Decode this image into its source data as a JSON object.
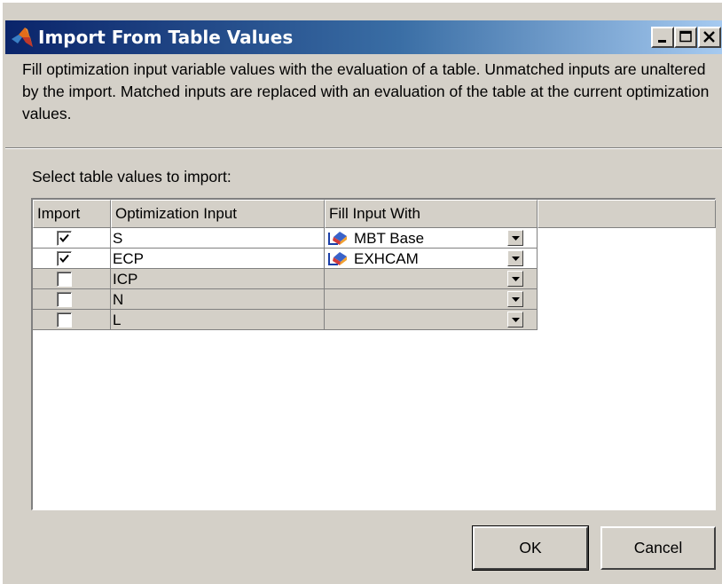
{
  "window": {
    "title": "Import From Table Values",
    "buttons": [
      "minimize",
      "maximize",
      "close"
    ]
  },
  "description": "Fill optimization input variable values with the evaluation of a table. Unmatched inputs are unaltered by the import. Matched inputs are replaced with an evaluation of the table at the current optimization values.",
  "select_label": "Select table values to import:",
  "table": {
    "headers": [
      "Import",
      "Optimization Input",
      "Fill Input With"
    ],
    "rows": [
      {
        "checked": true,
        "input": "S",
        "fill": "MBT  Base",
        "enabled": true
      },
      {
        "checked": true,
        "input": "ECP",
        "fill": "EXHCAM",
        "enabled": true
      },
      {
        "checked": false,
        "input": "ICP",
        "fill": "",
        "enabled": false
      },
      {
        "checked": false,
        "input": "N",
        "fill": "",
        "enabled": false
      },
      {
        "checked": false,
        "input": "L",
        "fill": "",
        "enabled": false
      }
    ]
  },
  "buttons": {
    "ok": "OK",
    "cancel": "Cancel"
  },
  "colors": {
    "title_gradient_start": "#0a246a",
    "title_gradient_end": "#a6caf0",
    "face": "#d4d0c8"
  }
}
